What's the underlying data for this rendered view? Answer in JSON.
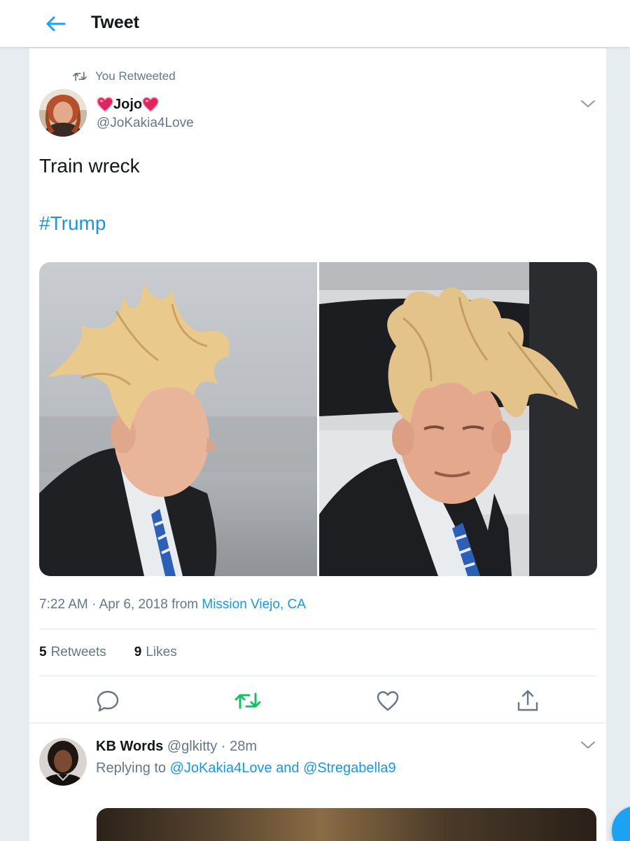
{
  "header": {
    "title": "Tweet",
    "back_icon": "arrow-left-icon",
    "accent_color": "#1da1f2"
  },
  "tweet": {
    "context": "You Retweeted",
    "author": {
      "display_name": "Jojo",
      "name_emoji": "heart-icon",
      "handle": "@JoKakia4Love"
    },
    "text": "Train wreck",
    "hashtag": "#Trump",
    "media_count": 2,
    "time": "7:22 AM",
    "separator": " · ",
    "date": "Apr 6, 2018",
    "from_word": " from ",
    "location": "Mission Viejo, CA",
    "stats": {
      "retweets_count": "5",
      "retweets_label": "Retweets",
      "likes_count": "9",
      "likes_label": "Likes"
    },
    "actions": [
      "reply-icon",
      "retweet-icon",
      "like-icon",
      "share-icon"
    ],
    "retweet_active_color": "#17bf63"
  },
  "reply": {
    "display_name": "KB Words",
    "handle": "@glkitty",
    "separator": " · ",
    "time": "28m",
    "replying_prefix": "Replying to ",
    "mention_1": "@JoKakia4Love",
    "and_word": " and ",
    "mention_2": "@Stregabella9"
  },
  "colors": {
    "link": "#1b95e0",
    "secondary_text": "#657786",
    "background": "#e6ecf0"
  }
}
